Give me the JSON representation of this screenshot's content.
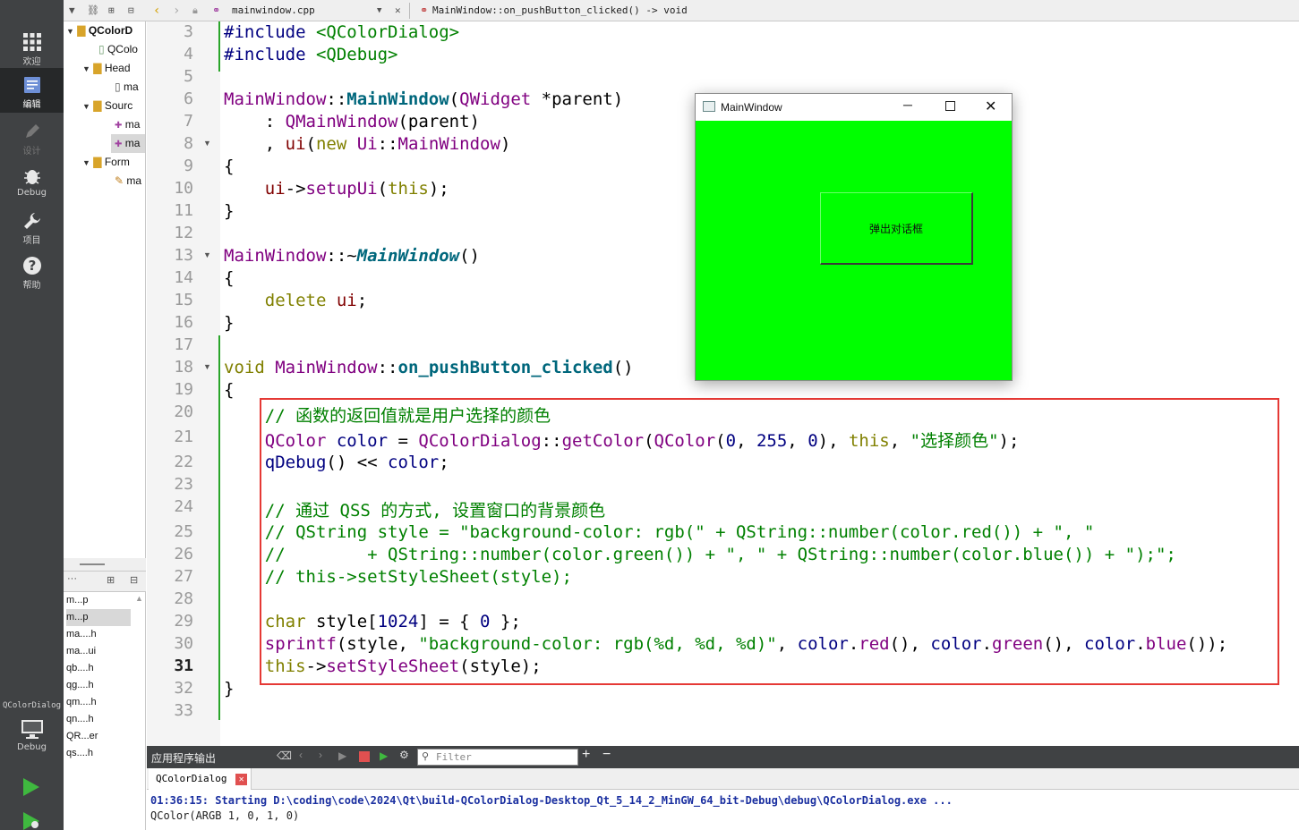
{
  "toolbar": {
    "file_name": "mainwindow.cpp",
    "function_name": "MainWindow::on_pushButton_clicked() -> void"
  },
  "modes": [
    {
      "label": "欢迎",
      "icon": "grid-icon"
    },
    {
      "label": "编辑",
      "icon": "edit-icon"
    },
    {
      "label": "设计",
      "icon": "pencil-icon"
    },
    {
      "label": "Debug",
      "icon": "bug-icon"
    },
    {
      "label": "项目",
      "icon": "wrench-icon"
    },
    {
      "label": "帮助",
      "icon": "help-icon"
    }
  ],
  "kit": {
    "project": "QColorDialog",
    "mode": "Debug"
  },
  "tree": [
    {
      "label": "QColorD"
    },
    {
      "label": "QColo"
    },
    {
      "label": "Head"
    },
    {
      "label": "ma"
    },
    {
      "label": "Sourc"
    },
    {
      "label": "ma"
    },
    {
      "label": "ma"
    },
    {
      "label": "Form"
    },
    {
      "label": "ma"
    }
  ],
  "open_docs": [
    "m...p",
    "m...p",
    "ma....h",
    "ma...ui",
    "qb....h",
    "qg....h",
    "qm....h",
    "qn....h",
    "QR...er",
    "qs....h"
  ],
  "line_numbers": [
    "3",
    "4",
    "5",
    "6",
    "7",
    "8",
    "9",
    "10",
    "11",
    "12",
    "13",
    "14",
    "15",
    "16",
    "17",
    "18",
    "19",
    "20",
    "21",
    "22",
    "23",
    "24",
    "25",
    "26",
    "27",
    "28",
    "29",
    "30",
    "31",
    "32",
    "33"
  ],
  "current_line": "31",
  "code": {
    "l3": [
      "#include",
      " <QColorDialog>"
    ],
    "l4": [
      "#include",
      " <QDebug>"
    ],
    "l6": [
      "MainWindow",
      "::",
      "MainWindow",
      "(",
      "QWidget",
      " *parent)"
    ],
    "l7": [
      "    : ",
      "QMainWindow",
      "(parent)"
    ],
    "l8": [
      "    , ",
      "ui",
      "(",
      "new",
      " ",
      "Ui",
      "::",
      "MainWindow",
      ")"
    ],
    "l9": [
      "{"
    ],
    "l10": [
      "    ",
      "ui",
      "->",
      "setupUi",
      "(",
      "this",
      ");"
    ],
    "l11": [
      "}"
    ],
    "l13": [
      "MainWindow",
      "::~",
      "MainWindow",
      "()"
    ],
    "l14": [
      "{"
    ],
    "l15": [
      "    ",
      "delete",
      " ",
      "ui",
      ";"
    ],
    "l16": [
      "}"
    ],
    "l18": [
      "void",
      " ",
      "MainWindow",
      "::",
      "on_pushButton_clicked",
      "()"
    ],
    "l19": [
      "{"
    ],
    "l20": "    // 函数的返回值就是用户选择的颜色",
    "l21": [
      "    ",
      "QColor",
      " ",
      "color",
      " = ",
      "QColorDialog",
      "::",
      "getColor",
      "(",
      "QColor",
      "(",
      "0",
      ", ",
      "255",
      ", ",
      "0",
      "), ",
      "this",
      ", ",
      "\"选择颜色\"",
      ");"
    ],
    "l22": [
      "    ",
      "qDebug",
      "() << ",
      "color",
      ";"
    ],
    "l24": "    // 通过 QSS 的方式, 设置窗口的背景颜色",
    "l25": "    // QString style = \"background-color: rgb(\" + QString::number(color.red()) + \", \"",
    "l26": "    //        + QString::number(color.green()) + \", \" + QString::number(color.blue()) + \");\";",
    "l27": "    // this->setStyleSheet(style);",
    "l29": [
      "    ",
      "char",
      " style[",
      "1024",
      "] = { ",
      "0",
      " };"
    ],
    "l30": [
      "    ",
      "sprintf",
      "(style, ",
      "\"background-color: rgb(%d, %d, %d)\"",
      ", ",
      "color",
      ".",
      "red",
      "(), ",
      "color",
      ".",
      "green",
      "(), ",
      "color",
      ".",
      "blue",
      "());"
    ],
    "l31": [
      "    ",
      "this",
      "->",
      "setStyleSheet",
      "(style);"
    ],
    "l32": [
      "}"
    ]
  },
  "window": {
    "title": "MainWindow",
    "button_label": "弹出对话框",
    "background": "#00ff00"
  },
  "output": {
    "pane_title": "应用程序输出",
    "filter_placeholder": "Filter",
    "tab_label": "QColorDialog",
    "line1": "01:36:15: Starting D:\\coding\\code\\2024\\Qt\\build-QColorDialog-Desktop_Qt_5_14_2_MinGW_64_bit-Debug\\debug\\QColorDialog.exe ...",
    "line2": "QColor(ARGB 1, 0, 1, 0)"
  }
}
